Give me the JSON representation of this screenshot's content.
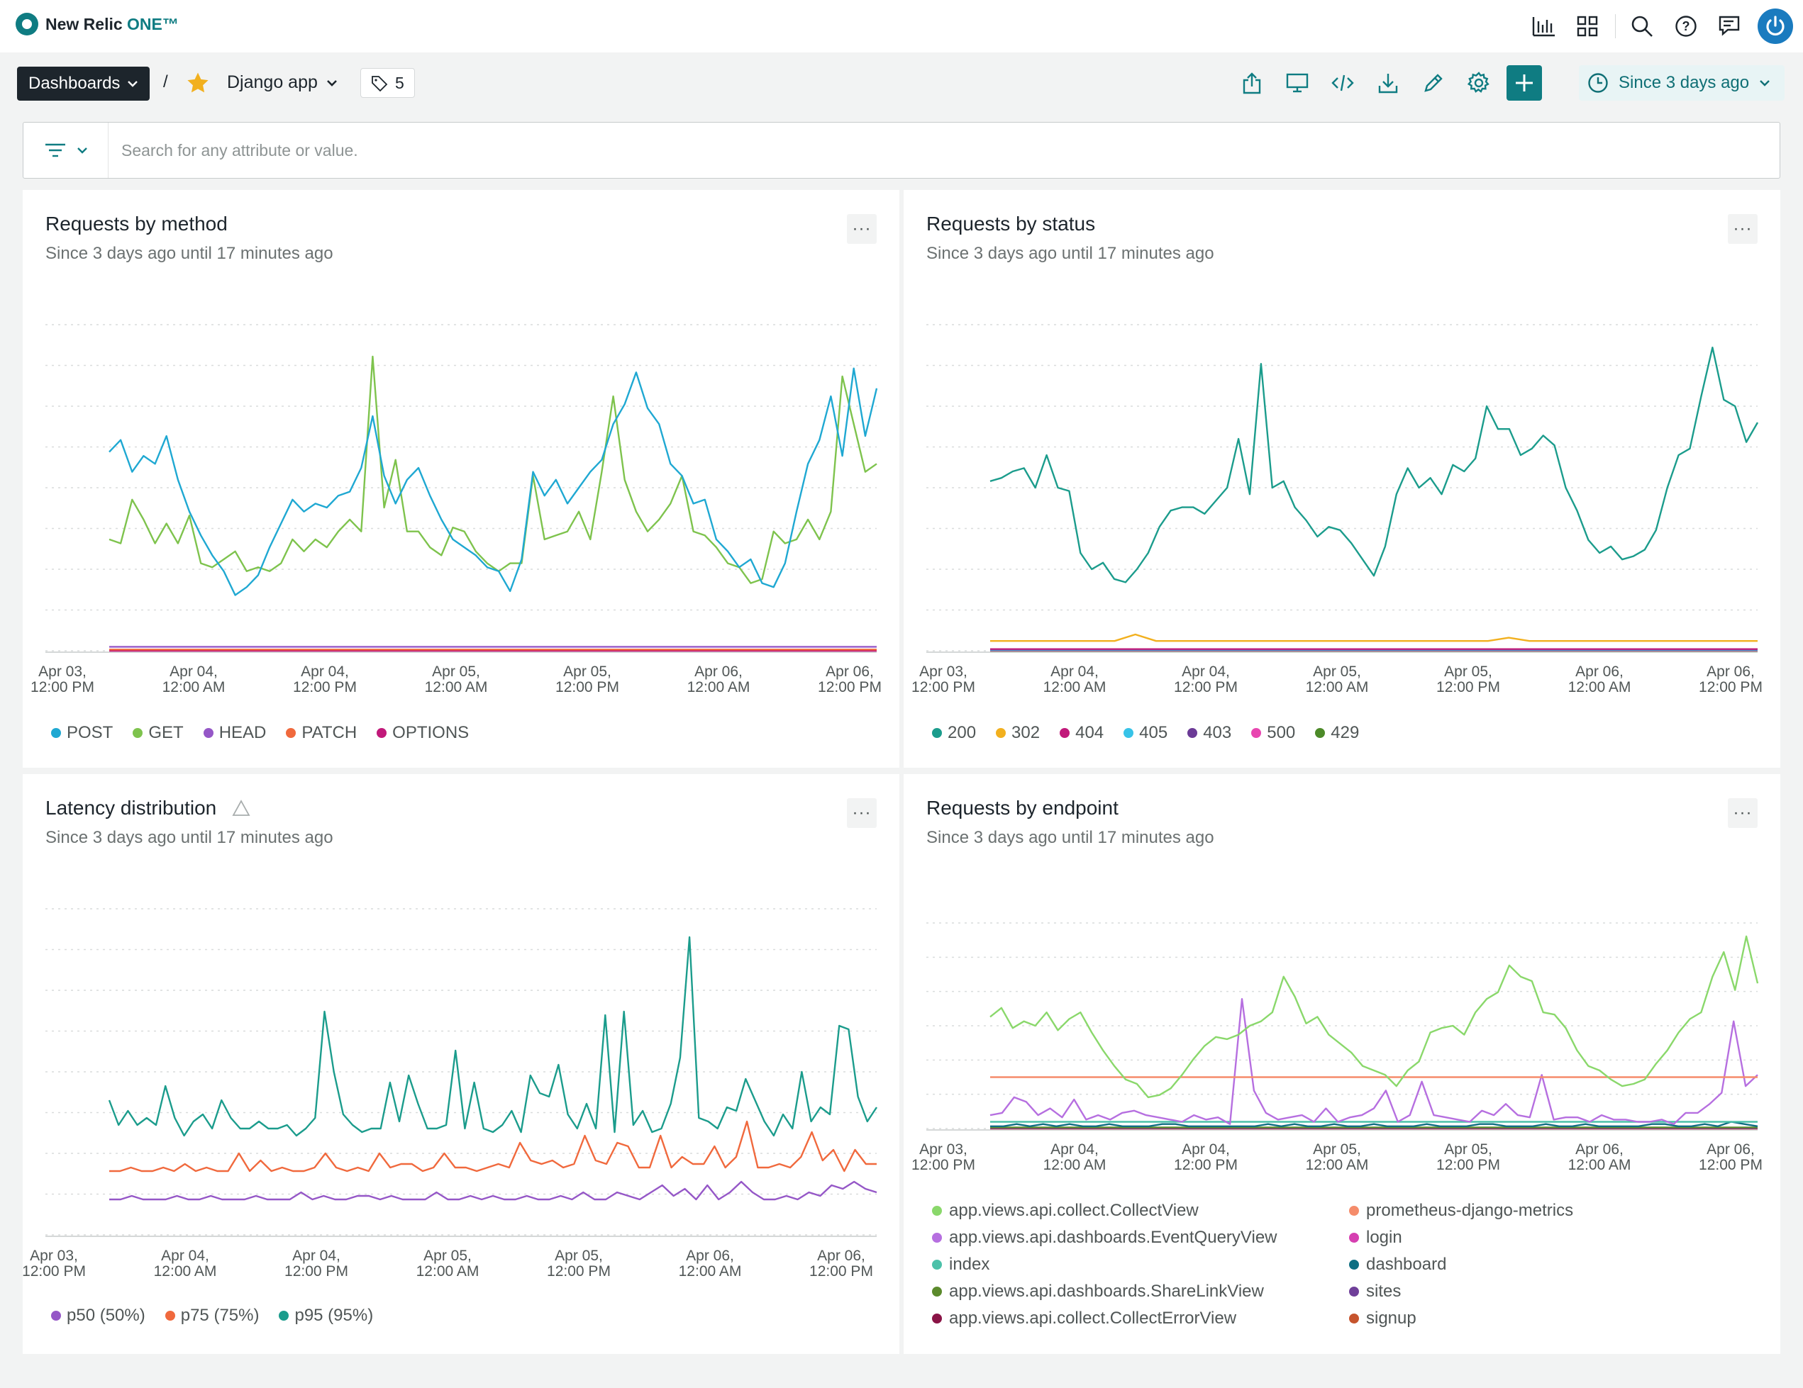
{
  "topbar": {
    "logo_text": "New Relic",
    "logo_suffix": "ONE™",
    "icons": [
      "chart-icon",
      "apps-grid-icon",
      "search-icon",
      "help-icon",
      "feedback-icon",
      "user-avatar-icon"
    ]
  },
  "toolbar": {
    "dashboards_label": "Dashboards",
    "separator": "/",
    "app_name": "Django app",
    "tag_count": "5",
    "time_label": "Since 3 days ago"
  },
  "filter": {
    "placeholder": "Search for any attribute or value."
  },
  "colors": {
    "accent": "#0f7c82",
    "star": "#f2b01e",
    "dark": "#1d252c"
  },
  "panels": {
    "method": {
      "title": "Requests by method",
      "subtitle": "Since 3 days ago until 17 minutes ago",
      "legend": [
        {
          "name": "POST",
          "color": "#1fa8d2"
        },
        {
          "name": "GET",
          "color": "#7ec34d"
        },
        {
          "name": "HEAD",
          "color": "#9557c7"
        },
        {
          "name": "PATCH",
          "color": "#f0693d"
        },
        {
          "name": "OPTIONS",
          "color": "#c1197a"
        }
      ]
    },
    "status": {
      "title": "Requests by status",
      "subtitle": "Since 3 days ago until 17 minutes ago",
      "legend": [
        {
          "name": "200",
          "color": "#1b9c8c"
        },
        {
          "name": "302",
          "color": "#f2b01e"
        },
        {
          "name": "404",
          "color": "#c1197a"
        },
        {
          "name": "405",
          "color": "#37c3e8"
        },
        {
          "name": "403",
          "color": "#6b3a96"
        },
        {
          "name": "500",
          "color": "#e846b0"
        },
        {
          "name": "429",
          "color": "#4c8a28"
        }
      ]
    },
    "latency": {
      "title": "Latency distribution",
      "subtitle": "Since 3 days ago until 17 minutes ago",
      "legend": [
        {
          "name": "p50 (50%)",
          "color": "#9557c7"
        },
        {
          "name": "p75 (75%)",
          "color": "#f0693d"
        },
        {
          "name": "p95 (95%)",
          "color": "#1b9c8c"
        }
      ]
    },
    "endpoint": {
      "title": "Requests by endpoint",
      "subtitle": "Since 3 days ago until 17 minutes ago",
      "legend": [
        {
          "name": "app.views.api.collect.CollectView",
          "color": "#8ad86b"
        },
        {
          "name": "prometheus-django-metrics",
          "color": "#f58c6b"
        },
        {
          "name": "app.views.api.dashboards.EventQueryView",
          "color": "#b66fe0"
        },
        {
          "name": "login",
          "color": "#d63fb1"
        },
        {
          "name": "index",
          "color": "#4cc1a9"
        },
        {
          "name": "dashboard",
          "color": "#0e6e82"
        },
        {
          "name": "app.views.api.dashboards.ShareLinkView",
          "color": "#5b8a2c"
        },
        {
          "name": "sites",
          "color": "#6f3f99"
        },
        {
          "name": "app.views.api.collect.CollectErrorView",
          "color": "#8a1446"
        },
        {
          "name": "signup",
          "color": "#c6542d"
        }
      ]
    }
  },
  "chart_data": [
    {
      "type": "line",
      "title": "Requests by method",
      "x_ticks": [
        "Apr 03, 12:00 PM",
        "Apr 04, 12:00 AM",
        "Apr 04, 12:00 PM",
        "Apr 05, 12:00 AM",
        "Apr 05, 12:00 PM",
        "Apr 06, 12:00 AM",
        "Apr 06, 12:00 PM"
      ],
      "series": [
        {
          "name": "POST",
          "values": [
            50,
            53,
            45,
            49,
            47,
            54,
            43,
            35,
            29,
            24,
            20,
            14,
            16,
            19,
            26,
            32,
            38,
            35,
            37,
            36,
            39,
            40,
            46,
            59,
            44,
            37,
            43,
            46,
            39,
            33,
            28,
            26,
            24,
            21,
            20,
            15,
            23,
            45,
            39,
            43,
            37,
            41,
            45,
            48,
            57,
            62,
            70,
            61,
            57,
            47,
            44,
            37,
            38,
            28,
            25,
            21,
            23,
            17,
            16,
            22,
            35,
            47,
            53,
            64,
            49,
            71,
            54,
            66
          ]
        },
        {
          "name": "GET",
          "values": [
            28,
            27,
            38,
            33,
            27,
            32,
            27,
            34,
            22,
            21,
            23,
            25,
            20,
            21,
            20,
            22,
            28,
            25,
            28,
            26,
            30,
            33,
            30,
            74,
            36,
            48,
            30,
            30,
            26,
            24,
            31,
            30,
            25,
            22,
            20,
            22,
            22,
            44,
            28,
            29,
            30,
            35,
            28,
            45,
            64,
            43,
            35,
            30,
            33,
            37,
            44,
            30,
            29,
            26,
            22,
            21,
            17,
            18,
            30,
            27,
            28,
            33,
            28,
            35,
            69,
            57,
            45,
            47
          ]
        },
        {
          "name": "HEAD",
          "values": [
            1,
            1,
            1,
            1,
            1,
            1,
            1,
            1,
            1,
            1,
            1,
            1,
            1,
            1,
            1,
            1,
            1,
            1,
            1,
            1
          ]
        },
        {
          "name": "PATCH",
          "values": [
            0.3,
            0.3,
            0.3,
            0.3,
            0.3,
            0.3,
            0.3,
            0.3,
            0.3,
            0.3
          ]
        },
        {
          "name": "OPTIONS",
          "values": [
            0,
            0,
            0,
            0,
            0,
            0,
            0,
            0,
            0,
            0
          ]
        }
      ]
    },
    {
      "type": "line",
      "title": "Requests by status",
      "x_ticks": [
        "Apr 03, 12:00 PM",
        "Apr 04, 12:00 AM",
        "Apr 04, 12:00 PM",
        "Apr 05, 12:00 AM",
        "Apr 05, 12:00 PM",
        "Apr 06, 12:00 AM",
        "Apr 06, 12:00 PM"
      ],
      "series": [
        {
          "name": "200",
          "values": [
            52,
            53,
            55,
            56,
            50,
            60,
            50,
            49,
            30,
            25,
            27,
            22,
            21,
            25,
            30,
            38,
            43,
            44,
            44,
            42,
            46,
            50,
            65,
            48,
            88,
            50,
            52,
            44,
            40,
            35,
            38,
            37,
            33,
            28,
            23,
            32,
            48,
            56,
            50,
            53,
            48,
            57,
            55,
            59,
            75,
            68,
            68,
            60,
            62,
            66,
            63,
            50,
            43,
            34,
            30,
            32,
            28,
            29,
            31,
            37,
            50,
            60,
            62,
            78,
            93,
            77,
            75,
            64,
            70
          ]
        },
        {
          "name": "302",
          "values": [
            3,
            3,
            3,
            3,
            3,
            3,
            3,
            5,
            3,
            3,
            3,
            3,
            3,
            3,
            3,
            3,
            3,
            3,
            3,
            3,
            3,
            3,
            3,
            3,
            3,
            4,
            3,
            3,
            3,
            3,
            3,
            3,
            3,
            3,
            3,
            3,
            3,
            3
          ]
        },
        {
          "name": "404",
          "values": [
            0.5,
            0.5,
            0.5,
            0.5,
            0.5
          ]
        },
        {
          "name": "405",
          "values": [
            0.3,
            0.3,
            0.3,
            0.3,
            0.3
          ]
        },
        {
          "name": "403",
          "values": [
            0.2,
            0.2,
            0.2,
            0.2,
            0.2
          ]
        },
        {
          "name": "500",
          "values": [
            0.1,
            0.1,
            0.1,
            0.1,
            0.1
          ]
        },
        {
          "name": "429",
          "values": [
            0,
            0,
            0,
            0,
            0
          ]
        }
      ]
    },
    {
      "type": "line",
      "title": "Latency distribution",
      "x_ticks": [
        "Apr 03, 12:00 PM",
        "Apr 04, 12:00 AM",
        "Apr 04, 12:00 PM",
        "Apr 05, 12:00 AM",
        "Apr 05, 12:00 PM",
        "Apr 06, 12:00 AM",
        "Apr 06, 12:00 PM"
      ],
      "series": [
        {
          "name": "p50 (50%)",
          "values": [
            10,
            10,
            11,
            10,
            10,
            10,
            11,
            10,
            10,
            11,
            10,
            10,
            10,
            11,
            10,
            10,
            10,
            12,
            10,
            11,
            10,
            10,
            11,
            11,
            10,
            11,
            10,
            10,
            10,
            12,
            10,
            10,
            11,
            10,
            11,
            10,
            10,
            11,
            10,
            10,
            11,
            10,
            12,
            10,
            10,
            12,
            11,
            10,
            12,
            14,
            11,
            13,
            10,
            14,
            10,
            12,
            15,
            12,
            10,
            10,
            11,
            10,
            12,
            11,
            14,
            13,
            15,
            13,
            12
          ]
        },
        {
          "name": "p75 (75%)",
          "values": [
            18,
            18,
            19,
            18,
            18,
            19,
            18,
            20,
            18,
            19,
            18,
            18,
            23,
            18,
            21,
            18,
            19,
            18,
            18,
            19,
            23,
            19,
            18,
            19,
            18,
            23,
            19,
            20,
            20,
            18,
            19,
            23,
            19,
            19,
            18,
            19,
            20,
            19,
            26,
            21,
            20,
            21,
            19,
            20,
            28,
            21,
            20,
            26,
            25,
            19,
            19,
            28,
            19,
            22,
            20,
            20,
            25,
            19,
            22,
            32,
            19,
            19,
            20,
            19,
            22,
            29,
            21,
            24,
            18,
            24,
            20,
            20
          ]
        },
        {
          "name": "p95 (95%)",
          "values": [
            38,
            31,
            35,
            31,
            33,
            31,
            42,
            33,
            28,
            32,
            34,
            30,
            38,
            33,
            30,
            30,
            32,
            30,
            30,
            31,
            28,
            30,
            33,
            63,
            46,
            34,
            31,
            29,
            30,
            30,
            43,
            32,
            45,
            37,
            30,
            30,
            31,
            52,
            30,
            43,
            30,
            29,
            31,
            35,
            29,
            45,
            40,
            39,
            48,
            34,
            30,
            37,
            30,
            62,
            29,
            63,
            31,
            35,
            29,
            30,
            37,
            50,
            84,
            33,
            32,
            30,
            36,
            35,
            44,
            38,
            32,
            28,
            34,
            30,
            46,
            32,
            36,
            34,
            59,
            58,
            39,
            32,
            36
          ]
        }
      ]
    },
    {
      "type": "line",
      "title": "Requests by endpoint",
      "x_ticks": [
        "Apr 03, 12:00 PM",
        "Apr 04, 12:00 AM",
        "Apr 04, 12:00 PM",
        "Apr 05, 12:00 AM",
        "Apr 05, 12:00 PM",
        "Apr 06, 12:00 AM",
        "Apr 06, 12:00 PM"
      ],
      "series": [
        {
          "name": "app.views.api.collect.CollectView",
          "values": [
            50,
            54,
            45,
            48,
            46,
            52,
            44,
            49,
            52,
            43,
            35,
            28,
            22,
            20,
            14,
            15,
            18,
            24,
            31,
            37,
            41,
            40,
            42,
            46,
            48,
            52,
            68,
            59,
            47,
            50,
            42,
            38,
            34,
            28,
            26,
            24,
            19,
            26,
            30,
            43,
            45,
            46,
            42,
            52,
            58,
            61,
            73,
            68,
            66,
            52,
            51,
            45,
            35,
            28,
            26,
            22,
            19,
            20,
            22,
            29,
            35,
            43,
            49,
            52,
            68,
            79,
            62,
            86,
            65
          ]
        },
        {
          "name": "prometheus-django-metrics",
          "values": [
            23,
            23,
            23,
            23,
            23,
            23,
            23,
            23,
            23,
            23,
            23,
            23,
            23,
            23,
            23,
            23
          ]
        },
        {
          "name": "app.views.api.dashboards.EventQueryView",
          "values": [
            6,
            7,
            14,
            12,
            6,
            9,
            5,
            13,
            4,
            6,
            4,
            7,
            8,
            6,
            5,
            4,
            3,
            6,
            4,
            5,
            2,
            58,
            17,
            7,
            4,
            5,
            6,
            3,
            9,
            3,
            5,
            6,
            9,
            17,
            3,
            6,
            21,
            6,
            5,
            4,
            3,
            8,
            6,
            11,
            6,
            5,
            24,
            4,
            5,
            5,
            3,
            6,
            4,
            4,
            3,
            3,
            4,
            2,
            7,
            7,
            11,
            16,
            48,
            19,
            24
          ]
        },
        {
          "name": "index",
          "values": [
            3,
            3,
            3,
            3,
            3,
            3,
            3,
            3,
            3,
            3
          ]
        },
        {
          "name": "dashboard",
          "values": [
            1,
            1,
            2,
            1,
            2,
            1,
            2,
            1,
            1,
            2,
            1,
            1,
            1,
            2,
            2,
            1,
            1,
            1,
            1,
            1,
            1,
            2,
            1,
            2,
            1,
            1,
            2,
            1,
            1,
            2,
            1,
            1,
            1,
            2,
            1,
            1,
            1,
            2,
            2,
            1,
            1,
            1,
            2,
            1,
            1,
            2,
            1,
            1,
            1,
            1,
            2,
            2,
            1,
            1,
            2,
            1,
            3,
            2,
            1
          ]
        },
        {
          "name": "app.views.api.dashboards.ShareLinkView",
          "values": [
            0.5,
            0.5,
            0.5,
            0.5,
            0.5
          ]
        },
        {
          "name": "sites",
          "values": [
            0.3,
            0.3,
            0.3,
            0.3,
            0.3
          ]
        },
        {
          "name": "app.views.api.collect.CollectErrorView",
          "values": [
            0.2,
            0.2,
            0.2,
            0.2,
            0.2
          ]
        },
        {
          "name": "login",
          "values": [
            0.1,
            0.1,
            0.1,
            0.1,
            0.1
          ]
        },
        {
          "name": "signup",
          "values": [
            0,
            0,
            0,
            0,
            0
          ]
        }
      ]
    }
  ]
}
